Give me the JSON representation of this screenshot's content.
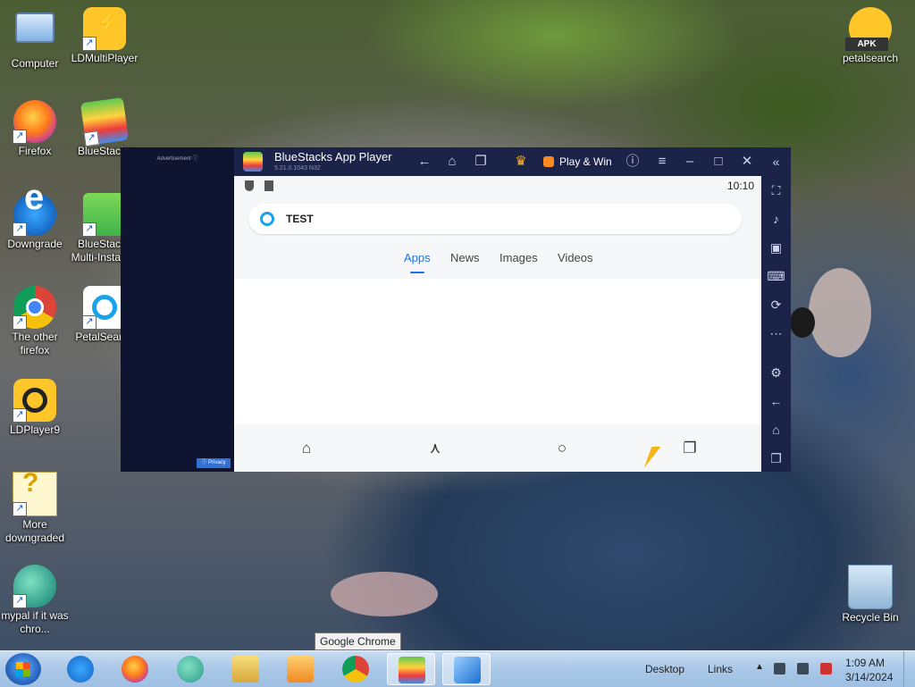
{
  "desktop_icons": [
    {
      "label": "Computer",
      "icon": "computer-icon"
    },
    {
      "label": "LDMultiPlayer",
      "icon": "ldmultiplayer-icon"
    },
    {
      "label": "Firefox",
      "icon": "firefox-icon"
    },
    {
      "label": "BlueStacks",
      "icon": "bluestacks-icon"
    },
    {
      "label": "Downgrade",
      "icon": "internet-explorer-icon"
    },
    {
      "label": "BlueStacks Multi-Instance",
      "icon": "bluestacks-multi-instance-icon"
    },
    {
      "label": "The other firefox",
      "icon": "chrome-icon"
    },
    {
      "label": "PetalSearch",
      "icon": "petalsearch-icon"
    },
    {
      "label": "LDPlayer9",
      "icon": "ldplayer9-icon"
    },
    {
      "label": "More downgraded",
      "icon": "unknown-file-icon"
    },
    {
      "label": "mypal if it was chro...",
      "icon": "mypal-icon"
    },
    {
      "label": "petalsearch",
      "icon": "apk-icon"
    },
    {
      "label": "Recycle Bin",
      "icon": "recycle-bin-icon"
    }
  ],
  "bluestacks": {
    "ad_label": "Advertisement ⓘ",
    "privacy_label": "ⓘ Privacy",
    "title": "BlueStacks App Player",
    "version": "5.21.0.1043  N32",
    "play_win_label": "Play & Win",
    "android": {
      "clock": "10:10",
      "search_text": "TEST",
      "tabs": [
        "Apps",
        "News",
        "Images",
        "Videos"
      ],
      "active_tab": "Apps"
    }
  },
  "taskbar": {
    "tooltip": "Google Chrome",
    "desktop_label": "Desktop",
    "links_label": "Links",
    "time": "1:09 AM",
    "date": "3/14/2024",
    "apps": [
      "internet-explorer",
      "firefox",
      "mypal",
      "file-explorer",
      "media-player",
      "google-chrome",
      "bluestacks",
      "shark"
    ],
    "active_app": "bluestacks"
  },
  "colors": {
    "bs_titlebar": "#1c2348",
    "accent_blue": "#1a73e8",
    "taskbar": "#a9c8e8"
  }
}
